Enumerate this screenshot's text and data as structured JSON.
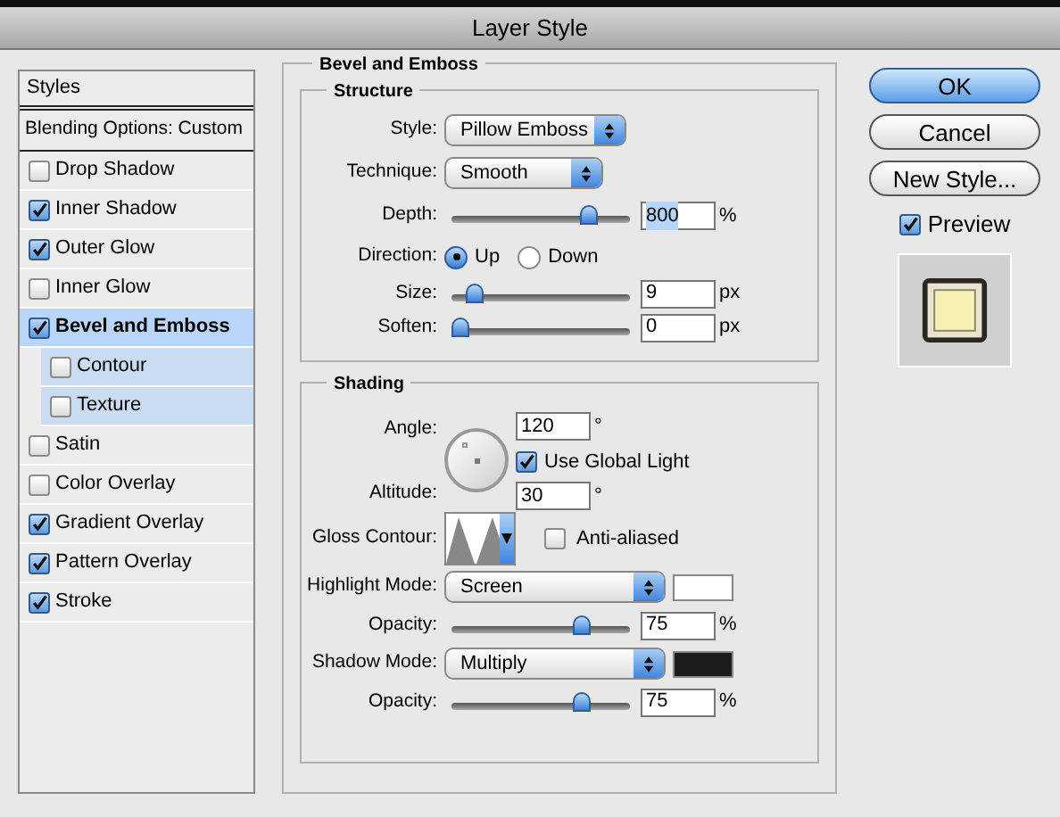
{
  "window": {
    "title": "Layer Style"
  },
  "sidebar": {
    "header": "Styles",
    "items": [
      {
        "kind": "heading",
        "label": "Blending Options: Custom",
        "selected": false
      },
      {
        "kind": "effect",
        "label": "Drop Shadow",
        "checked": false,
        "selected": false
      },
      {
        "kind": "effect",
        "label": "Inner Shadow",
        "checked": true,
        "selected": false
      },
      {
        "kind": "effect",
        "label": "Outer Glow",
        "checked": true,
        "selected": false
      },
      {
        "kind": "effect",
        "label": "Inner Glow",
        "checked": false,
        "selected": false
      },
      {
        "kind": "effect",
        "label": "Bevel and Emboss",
        "checked": true,
        "selected": true,
        "children": [
          {
            "label": "Contour",
            "checked": false,
            "selected": false
          },
          {
            "label": "Texture",
            "checked": false,
            "selected": false
          }
        ]
      },
      {
        "kind": "effect",
        "label": "Satin",
        "checked": false,
        "selected": false
      },
      {
        "kind": "effect",
        "label": "Color Overlay",
        "checked": false,
        "selected": false
      },
      {
        "kind": "effect",
        "label": "Gradient Overlay",
        "checked": true,
        "selected": false
      },
      {
        "kind": "effect",
        "label": "Pattern Overlay",
        "checked": true,
        "selected": false
      },
      {
        "kind": "effect",
        "label": "Stroke",
        "checked": true,
        "selected": false
      }
    ]
  },
  "panel": {
    "title": "Bevel and Emboss",
    "structure": {
      "title": "Structure",
      "fields": [
        {
          "kind": "select",
          "label": "Style:",
          "value": "Pillow Emboss"
        },
        {
          "kind": "select",
          "label": "Technique:",
          "value": "Smooth"
        },
        {
          "kind": "slider",
          "label": "Depth:",
          "level": 0.8,
          "value": "800",
          "unit": "%",
          "text_selected": true
        },
        {
          "kind": "radio",
          "label": "Direction:",
          "options": [
            {
              "label": "Up",
              "selected": true
            },
            {
              "label": "Down",
              "selected": false
            }
          ]
        },
        {
          "kind": "slider",
          "label": "Size:",
          "level": 0.09,
          "value": "9",
          "unit": "px",
          "text_selected": false
        },
        {
          "kind": "slider",
          "label": "Soften:",
          "level": 0,
          "value": "0",
          "unit": "px",
          "text_selected": false
        }
      ]
    },
    "shading": {
      "title": "Shading",
      "fields": [
        {
          "kind": "angle",
          "angle_label": "Angle:",
          "angle": "120",
          "angle_unit": "°",
          "global_light": {
            "label": "Use Global Light",
            "checked": true
          },
          "altitude_label": "Altitude:",
          "altitude": "30",
          "altitude_unit": "°"
        },
        {
          "kind": "contour",
          "label": "Gloss Contour:",
          "option": {
            "label": "Anti-aliased",
            "checked": false
          }
        },
        {
          "kind": "select_color",
          "label": "Highlight Mode:",
          "value": "Screen",
          "color": "#ffffff"
        },
        {
          "kind": "slider",
          "label": "Opacity:",
          "level": 0.75,
          "value": "75",
          "unit": "%",
          "text_selected": false
        },
        {
          "kind": "select_color",
          "label": "Shadow Mode:",
          "value": "Multiply",
          "color": "#1c1c1c"
        },
        {
          "kind": "slider",
          "label": "Opacity:",
          "level": 0.75,
          "value": "75",
          "unit": "%",
          "text_selected": false
        }
      ]
    }
  },
  "buttons": [
    {
      "label": "OK",
      "default": true
    },
    {
      "label": "Cancel",
      "default": false
    },
    {
      "label": "New Style...",
      "default": false
    }
  ],
  "preview": {
    "label": "Preview",
    "checked": true
  }
}
